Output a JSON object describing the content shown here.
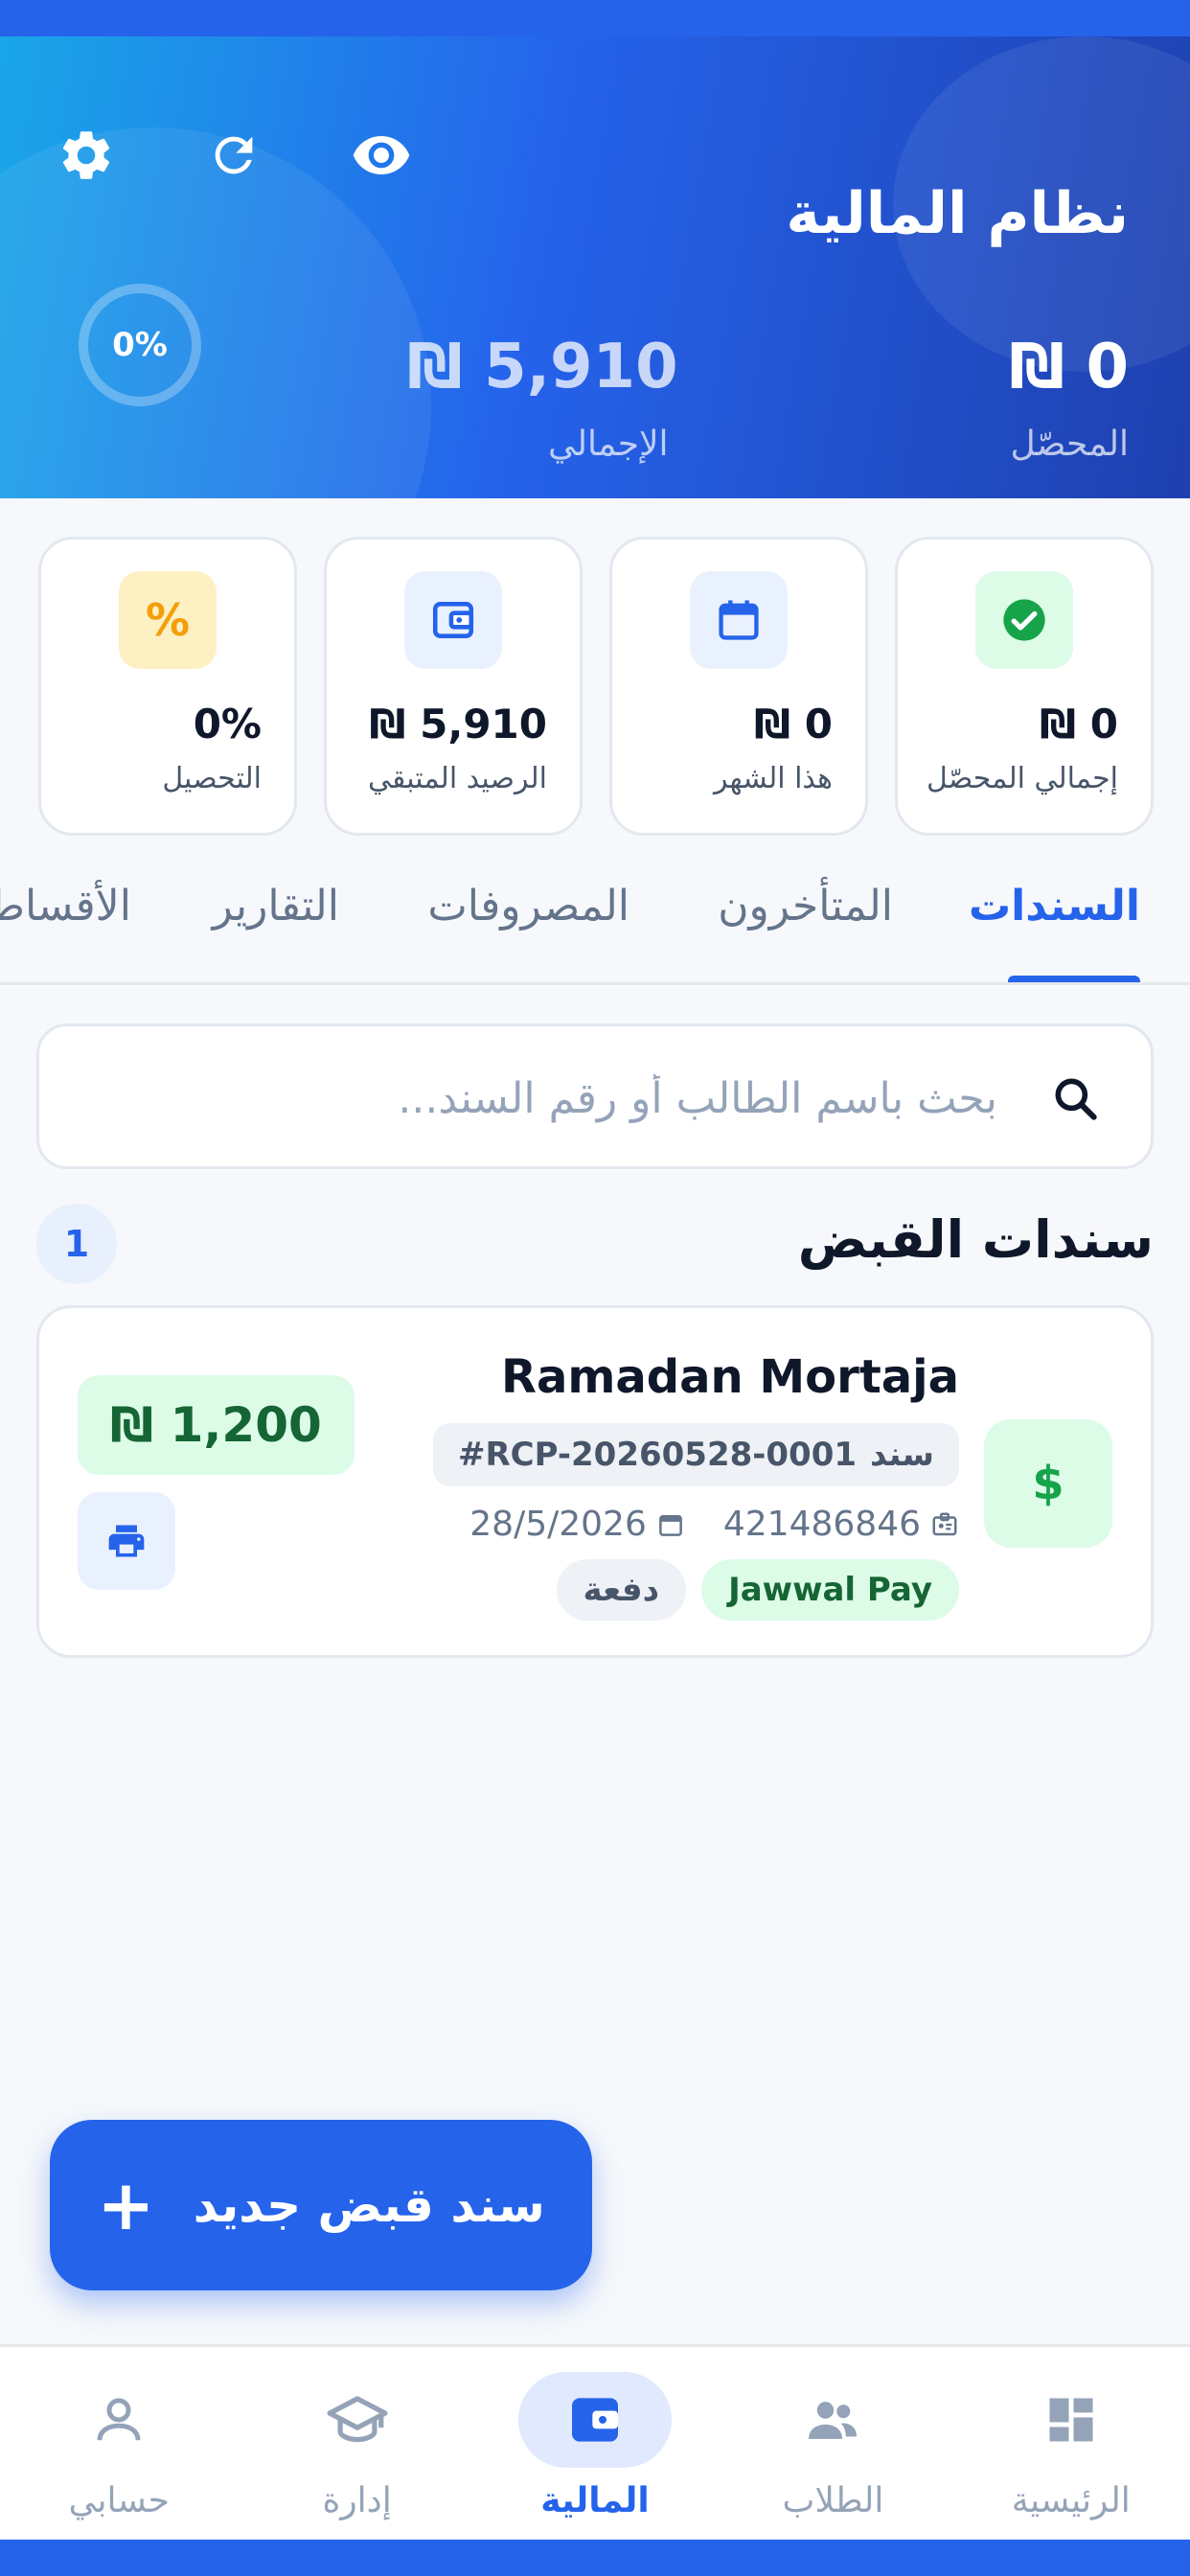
{
  "colors": {
    "primary": "#2563eb",
    "success": "#16a34a",
    "warning": "#f59e0b",
    "card_border": "#e3e8ef"
  },
  "header": {
    "title": "نظام المالية",
    "percent": "0%",
    "collected_amount": "₪ 0",
    "collected_label": "المحصّل",
    "total_amount": "₪ 5,910",
    "total_label": "الإجمالي",
    "icons": [
      "settings-icon",
      "refresh-icon",
      "eye-icon"
    ]
  },
  "stats": [
    {
      "value": "₪ 0",
      "label": "إجمالي المحصّل",
      "icon": "check-circle-icon",
      "color": "#16a34a"
    },
    {
      "value": "₪ 0",
      "label": "هذا الشهر",
      "icon": "calendar-icon",
      "color": "#2563eb"
    },
    {
      "value": "₪ 5,910",
      "label": "الرصيد المتبقي",
      "icon": "wallet-icon",
      "color": "#2563eb"
    },
    {
      "value": "0%",
      "label": "التحصيل",
      "icon": "percent-icon",
      "color": "#f59e0b"
    }
  ],
  "tabs": [
    {
      "label": "السندات",
      "active": true
    },
    {
      "label": "المتأخرون",
      "active": false
    },
    {
      "label": "المصروفات",
      "active": false
    },
    {
      "label": "التقارير",
      "active": false
    },
    {
      "label": "الأقساط",
      "active": false
    }
  ],
  "search": {
    "placeholder": "بحث باسم الطالب أو رقم السند..."
  },
  "section": {
    "title": "سندات القبض",
    "count": "1"
  },
  "receipt": {
    "name": "Ramadan Mortaja",
    "number_prefix": "سند",
    "number": "#RCP-20260528-0001",
    "id": "421486846",
    "date": "28/5/2026",
    "method": "Jawwal Pay",
    "type": "دفعة",
    "amount": "₪ 1,200"
  },
  "fab": {
    "label": "سند قبض جديد"
  },
  "nav": [
    {
      "label": "الرئيسية",
      "icon": "dashboard-icon",
      "active": false
    },
    {
      "label": "الطلاب",
      "icon": "people-icon",
      "active": false
    },
    {
      "label": "المالية",
      "icon": "wallet-icon",
      "active": true
    },
    {
      "label": "إدارة",
      "icon": "graduation-cap-icon",
      "active": false
    },
    {
      "label": "حسابي",
      "icon": "person-icon",
      "active": false
    }
  ]
}
